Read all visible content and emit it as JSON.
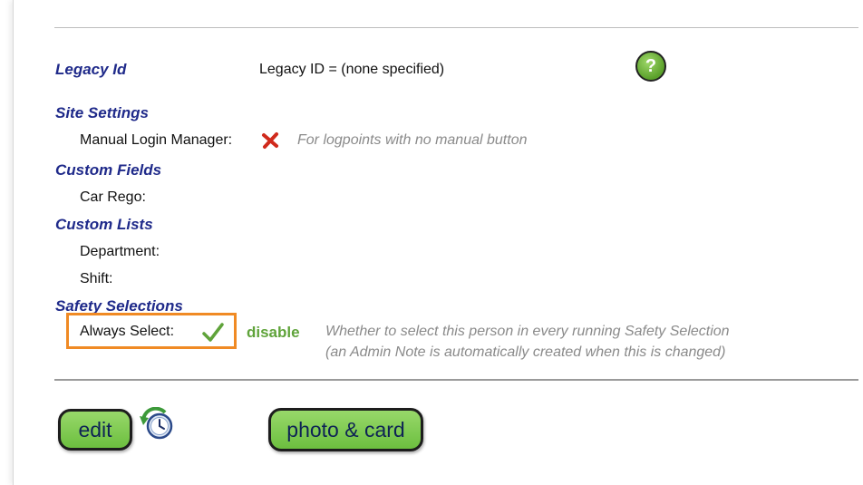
{
  "legacy": {
    "heading": "Legacy Id",
    "value": "Legacy ID = (none specified)",
    "help_glyph": "?"
  },
  "site_settings": {
    "heading": "Site Settings",
    "manual_login_label": "Manual Login Manager:",
    "manual_login_state_icon": "red-x-icon",
    "manual_login_hint": "For logpoints with no manual button"
  },
  "custom_fields": {
    "heading": "Custom Fields",
    "car_rego_label": "Car Rego:"
  },
  "custom_lists": {
    "heading": "Custom Lists",
    "department_label": "Department:",
    "shift_label": "Shift:"
  },
  "safety_selections": {
    "heading": "Safety Selections",
    "always_select_label": "Always Select:",
    "always_select_state_icon": "green-check-icon",
    "disable_label": "disable",
    "hint_line1": "Whether to select this person in every running Safety Selection",
    "hint_line2": "(an Admin Note is automatically created when this is changed)"
  },
  "actions": {
    "edit_label": "edit",
    "photo_card_label": "photo & card"
  },
  "colors": {
    "section_heading": "#1f2a8a",
    "button_green": "#6cbf3f",
    "disable_green": "#5fa33a",
    "highlight_orange": "#f08a24",
    "x_red": "#d02a1c"
  }
}
